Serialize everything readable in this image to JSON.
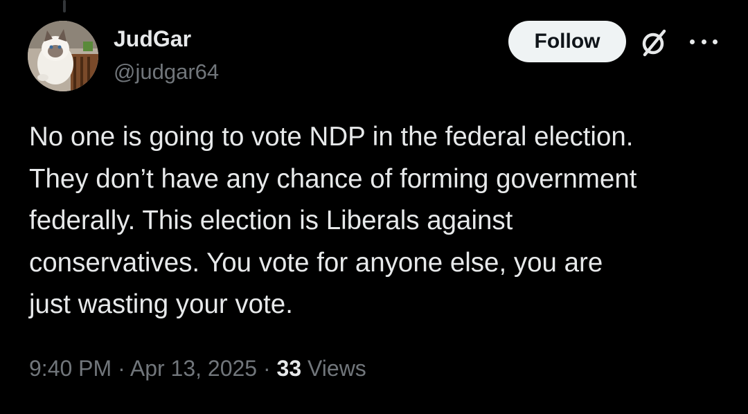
{
  "author": {
    "display_name": "JudGar",
    "handle": "@judgar64",
    "avatar": "cat-on-chair-photo"
  },
  "actions": {
    "follow_label": "Follow",
    "grok_icon": "grok-slash-icon",
    "more_icon": "more-options-icon"
  },
  "tweet": {
    "text": "No one is going to vote NDP in the federal election.\nThey don’t have any chance of forming government\nfederally. This election is Liberals against\nconservatives. You vote for anyone else, you are\njust wasting your vote."
  },
  "meta": {
    "time": "9:40 PM",
    "separator": "·",
    "date": "Apr 13, 2025",
    "views_count": "33",
    "views_label": "Views"
  },
  "colors": {
    "background": "#000000",
    "primary_text": "#e7e9ea",
    "secondary_text": "#71767b",
    "follow_bg": "#eff3f4",
    "follow_text": "#0f1419"
  }
}
